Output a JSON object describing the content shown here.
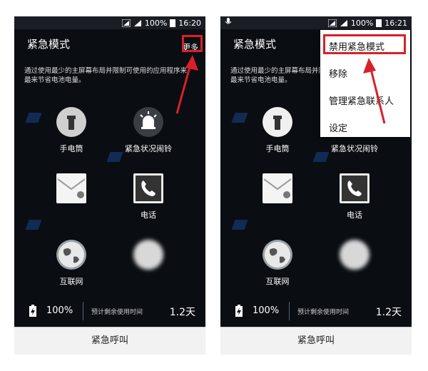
{
  "status_bar": {
    "battery_text": "100%",
    "time_left": "16:20",
    "time_right": "16:21"
  },
  "screen": {
    "title": "紧急模式",
    "more_label": "更多",
    "description": "通过使用最少的主屏幕布局并限制可使用的应用程序来\n最来节省电池电量。",
    "apps": [
      {
        "label": "手电筒",
        "icon": "flashlight-icon"
      },
      {
        "label": "紧急状况闹铃",
        "icon": "siren-icon"
      },
      {
        "label": "",
        "icon": "message-icon"
      },
      {
        "label": "电话",
        "icon": "phone-icon"
      },
      {
        "label": "互联网",
        "icon": "globe-icon"
      },
      {
        "label": "",
        "icon": "add-icon"
      }
    ],
    "battery": {
      "percent": "100%",
      "estimate_label": "预计剩余使用时间",
      "days": "1.2天"
    },
    "emergency_call": "紧急呼叫"
  },
  "menu": {
    "items": [
      "禁用紧急模式",
      "移除",
      "管理紧急联系人",
      "设定"
    ]
  },
  "colors": {
    "highlight": "#d9202a",
    "background": "#0a0d12",
    "accent": "#18458a"
  }
}
